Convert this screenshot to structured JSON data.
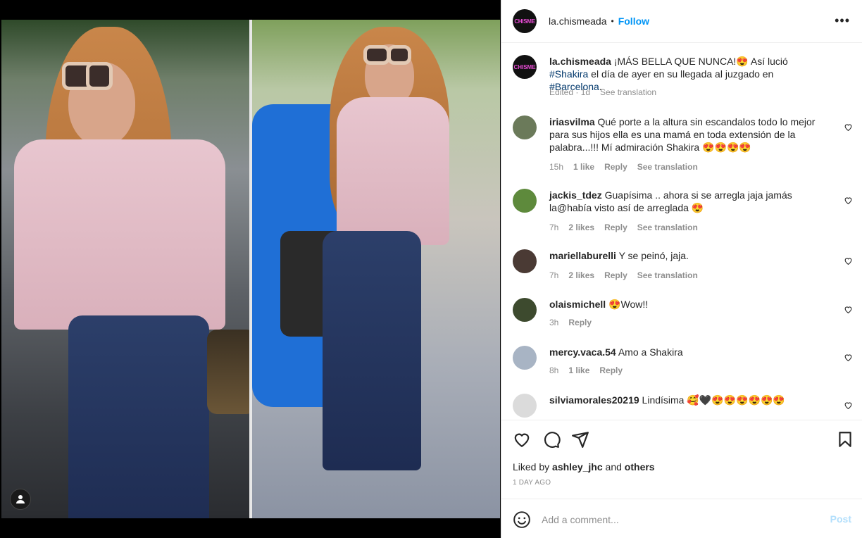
{
  "post": {
    "username": "la.chismeada",
    "follow_label": "Follow",
    "logo_text": "CHISME"
  },
  "caption": {
    "username": "la.chismeada",
    "text_1": " ¡MÁS BELLA QUE NUNCA!😍 Así lució ",
    "tag_1": "#Shakira",
    "text_2": " el día de ayer en su llegada al juzgado en ",
    "tag_2": "#Barcelona",
    "text_3": ".",
    "edited": "Edited · 1d",
    "translate": "See translation"
  },
  "comments": [
    {
      "username": "iriasvilma",
      "text": " Qué porte a la altura sin escandalos todo lo mejor para sus hijos ella es una mamá en toda extensión de la palabra...!!! Mí admiración Shakira 😍😍😍😍",
      "time": "15h",
      "likes": "1 like",
      "reply": "Reply",
      "translate": "See translation",
      "avatar_color": "#6b7a5a"
    },
    {
      "username": "jackis_tdez",
      "text": " Guapísima .. ahora si se arregla jaja jamás la@había visto así de arreglada 😍",
      "time": "7h",
      "likes": "2 likes",
      "reply": "Reply",
      "translate": "See translation",
      "avatar_color": "#5e8a3c"
    },
    {
      "username": "mariellaburelli",
      "text": " Y se peinó, jaja.",
      "time": "7h",
      "likes": "2 likes",
      "reply": "Reply",
      "translate": "See translation",
      "avatar_color": "#4a3a34"
    },
    {
      "username": "olaismichell",
      "text": " 😍Wow!!",
      "time": "3h",
      "likes": "",
      "reply": "Reply",
      "translate": "",
      "avatar_color": "#3d4a2e"
    },
    {
      "username": "mercy.vaca.54",
      "text": " Amo a Shakira",
      "time": "8h",
      "likes": "1 like",
      "reply": "Reply",
      "translate": "",
      "avatar_color": "#a8b4c4"
    },
    {
      "username": "silviamorales20219",
      "text": " Lindísima 🥰🖤😍😍😍😍😍😍",
      "time": "",
      "likes": "",
      "reply": "",
      "translate": "",
      "avatar_color": "#dbdbdb"
    }
  ],
  "actions": {
    "liked_prefix": "Liked by ",
    "liked_user": "ashley_jhc",
    "liked_mid": " and ",
    "liked_others": "others",
    "timestamp": "1 DAY AGO"
  },
  "add_comment": {
    "placeholder": "Add a comment...",
    "post_label": "Post"
  },
  "colors": {
    "link_blue": "#0095f6",
    "tag_blue": "#00376b",
    "post_disabled": "#b2dffc",
    "muted": "#8e8e8e"
  }
}
